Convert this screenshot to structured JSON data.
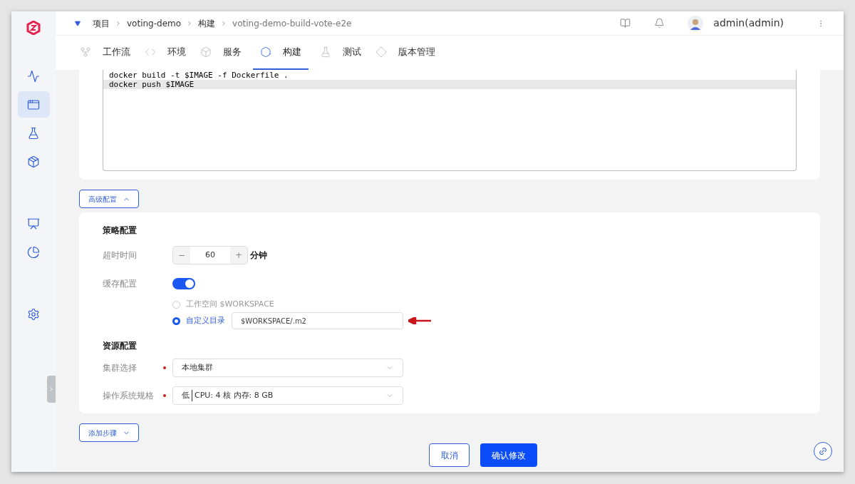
{
  "breadcrumb": [
    "项目",
    "voting-demo",
    "构建",
    "voting-demo-build-vote-e2e"
  ],
  "user": {
    "name": "admin(admin)"
  },
  "sidebar": {
    "items": [
      {
        "selected": false
      },
      {
        "selected": true
      },
      {
        "selected": false
      },
      {
        "selected": false
      },
      {
        "selected": false
      },
      {
        "selected": false
      },
      {
        "selected": false
      }
    ]
  },
  "tabs": [
    {
      "label": "工作流",
      "selected": false
    },
    {
      "label": "环境",
      "selected": false
    },
    {
      "label": "服务",
      "selected": false
    },
    {
      "label": "构建",
      "selected": true
    },
    {
      "label": "测试",
      "selected": false
    },
    {
      "label": "版本管理",
      "selected": false
    }
  ],
  "script": {
    "lines": [
      {
        "text": "docker build -t $IMAGE -f Dockerfile .",
        "active": false
      },
      {
        "text": "docker push $IMAGE",
        "active": true
      }
    ]
  },
  "advanced_button": {
    "label": "高级配置",
    "expanded": true
  },
  "strategy": {
    "title": "策略配置",
    "timeout": {
      "label": "超时时间",
      "minus": "−",
      "value": "60",
      "plus": "+",
      "unit": "分钟"
    },
    "cache": {
      "label": "缓存配置",
      "on": true,
      "options": [
        {
          "label": "工作空间 $WORKSPACE",
          "selected": false
        },
        {
          "label": "自定义目录",
          "selected": true,
          "value": "$WORKSPACE/.m2"
        }
      ]
    }
  },
  "resources": {
    "title": "资源配置",
    "fields": [
      {
        "label": "集群选择",
        "required": true,
        "value": "本地集群"
      },
      {
        "label": "操作系统规格",
        "required": true,
        "level_text": "低",
        "value": "CPU: 4 核 内存: 8 GB"
      }
    ]
  },
  "add_step_button": {
    "label": "添加步骤"
  },
  "footer": {
    "cancel": "取消",
    "confirm": "确认修改"
  }
}
